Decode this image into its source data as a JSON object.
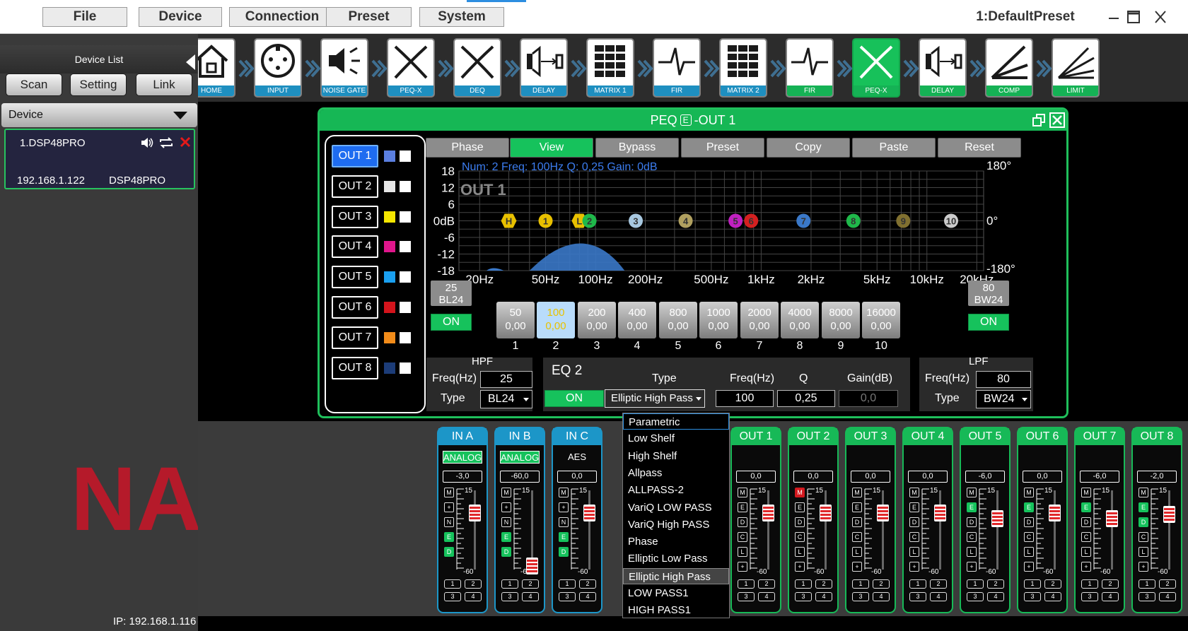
{
  "menu": {
    "items": [
      "File",
      "Device",
      "Connection",
      "Preset",
      "System"
    ],
    "preset": "1:DefaultPreset"
  },
  "toolbar": {
    "modules": [
      {
        "label": "HOME",
        "icon": "home-icon"
      },
      {
        "label": "INPUT",
        "icon": "xlr-input-icon"
      },
      {
        "label": "NOISE GATE",
        "icon": "speaker-gate-icon"
      },
      {
        "label": "PEQ-X",
        "icon": "crossover-icon"
      },
      {
        "label": "DEQ",
        "icon": "crossover-icon"
      },
      {
        "label": "DELAY",
        "icon": "delay-speaker-icon"
      },
      {
        "label": "MATRIX 1",
        "icon": "matrix-icon"
      },
      {
        "label": "FIR",
        "icon": "waveform-icon"
      },
      {
        "label": "MATRIX 2",
        "icon": "matrix-icon"
      },
      {
        "label": "FIR",
        "icon": "waveform-icon"
      },
      {
        "label": "PEQ-X",
        "icon": "crossover-icon"
      },
      {
        "label": "DELAY",
        "icon": "delay-speaker-icon"
      },
      {
        "label": "COMP",
        "icon": "compressor-icon"
      },
      {
        "label": "LIMIT",
        "icon": "limiter-icon"
      }
    ]
  },
  "sidebar": {
    "title": "Device List",
    "buttons": [
      "Scan",
      "Setting",
      "Link"
    ],
    "device_label": "Device",
    "device": {
      "name": "1.DSP48PRO",
      "ip": "192.168.1.122",
      "model": "DSP48PRO"
    },
    "status_ip": "IP: 192.168.1.116"
  },
  "dialog": {
    "title_pre": "PEQ",
    "title_e": "E",
    "title_post": "-OUT 1",
    "outputs": [
      {
        "label": "OUT 1",
        "color": "#5b7fe0"
      },
      {
        "label": "OUT 2",
        "color": "#e6e6e6"
      },
      {
        "label": "OUT 3",
        "color": "#f5e600"
      },
      {
        "label": "OUT 4",
        "color": "#e0168c"
      },
      {
        "label": "OUT 5",
        "color": "#1aa0f0"
      },
      {
        "label": "OUT 6",
        "color": "#d4141c"
      },
      {
        "label": "OUT 7",
        "color": "#f28c1a"
      },
      {
        "label": "OUT 8",
        "color": "#1c3c78"
      }
    ],
    "toolbar": [
      "Phase",
      "View",
      "Bypass",
      "Preset",
      "Copy",
      "Paste",
      "Reset"
    ],
    "graph": {
      "info": "Num: 2   Freq: 100Hz   Q: 0,25    Gain: 0dB",
      "channel": "OUT 1",
      "y_labels": [
        "18",
        "12",
        "6",
        "0dB",
        "-6",
        "-12",
        "-18"
      ],
      "phase_labels": [
        "180°",
        "0°",
        "-180°"
      ],
      "x_labels": [
        "20Hz",
        "50Hz",
        "100Hz",
        "200Hz",
        "500Hz",
        "1kHz",
        "2kHz",
        "5kHz",
        "10kHz",
        "20kHz"
      ]
    },
    "hpf_box": {
      "freq": "25",
      "type": "BL24",
      "on": "ON"
    },
    "lpf_box": {
      "freq": "80",
      "type": "BW24",
      "on": "ON"
    },
    "bands": [
      {
        "freq": "50",
        "gain": "0,00"
      },
      {
        "freq": "100",
        "gain": "0,00"
      },
      {
        "freq": "200",
        "gain": "0,00"
      },
      {
        "freq": "400",
        "gain": "0,00"
      },
      {
        "freq": "800",
        "gain": "0,00"
      },
      {
        "freq": "1000",
        "gain": "0,00"
      },
      {
        "freq": "2000",
        "gain": "0,00"
      },
      {
        "freq": "4000",
        "gain": "0,00"
      },
      {
        "freq": "8000",
        "gain": "0,00"
      },
      {
        "freq": "16000",
        "gain": "0,00"
      }
    ],
    "band_numbers": [
      "1",
      "2",
      "3",
      "4",
      "5",
      "6",
      "7",
      "8",
      "9",
      "10"
    ],
    "hpf": {
      "title": "HPF",
      "freq_label": "Freq(Hz)",
      "freq": "25",
      "type_label": "Type",
      "type": "BL24"
    },
    "eq": {
      "title": "EQ 2",
      "on": "ON",
      "type_label": "Type",
      "type": "Elliptic High Pass",
      "freq_label": "Freq(Hz)",
      "q_label": "Q",
      "gain_label": "Gain(dB)",
      "freq": "100",
      "q": "0,25",
      "gain": "0,0"
    },
    "lpf": {
      "title": "LPF",
      "freq_label": "Freq(Hz)",
      "freq": "80",
      "type_label": "Type",
      "type": "BW24"
    }
  },
  "dropdown": {
    "items": [
      "Parametric",
      "Low Shelf",
      "High Shelf",
      "Allpass",
      "ALLPASS-2",
      "VariQ LOW PASS",
      "VariQ High PASS",
      "Phase",
      "Elliptic Low Pass",
      "Elliptic High Pass",
      "LOW PASS1",
      "HIGH PASS1"
    ],
    "selected": "Elliptic High Pass"
  },
  "mixer": {
    "strips": [
      {
        "name": "IN A",
        "type": "in",
        "source": "ANALOG",
        "gain": "-3,0",
        "level": 0.8
      },
      {
        "name": "IN B",
        "type": "in",
        "source": "ANALOG",
        "gain": "-60,0",
        "level": 0.05
      },
      {
        "name": "IN C",
        "type": "in",
        "source": "AES",
        "gain": "0,0",
        "level": 0.8
      },
      {
        "name": "OUT 1",
        "type": "out",
        "gain": "0,0",
        "level": 0.8
      },
      {
        "name": "OUT 2",
        "type": "out",
        "gain": "0,0",
        "level": 0.8
      },
      {
        "name": "OUT 3",
        "type": "out",
        "gain": "0,0",
        "level": 0.8
      },
      {
        "name": "OUT 4",
        "type": "out",
        "gain": "0,0",
        "level": 0.8
      },
      {
        "name": "OUT 5",
        "type": "out",
        "gain": "-6,0",
        "level": 0.72
      },
      {
        "name": "OUT 6",
        "type": "out",
        "gain": "0,0",
        "level": 0.8
      },
      {
        "name": "OUT 7",
        "type": "out",
        "gain": "-6,0",
        "level": 0.72
      },
      {
        "name": "OUT 8",
        "type": "out",
        "gain": "-2,0",
        "level": 0.78
      }
    ],
    "scale_top": "15",
    "scale_bottom": "-60"
  },
  "logo": {
    "text": "NAG",
    "color": "#b51a2a"
  }
}
